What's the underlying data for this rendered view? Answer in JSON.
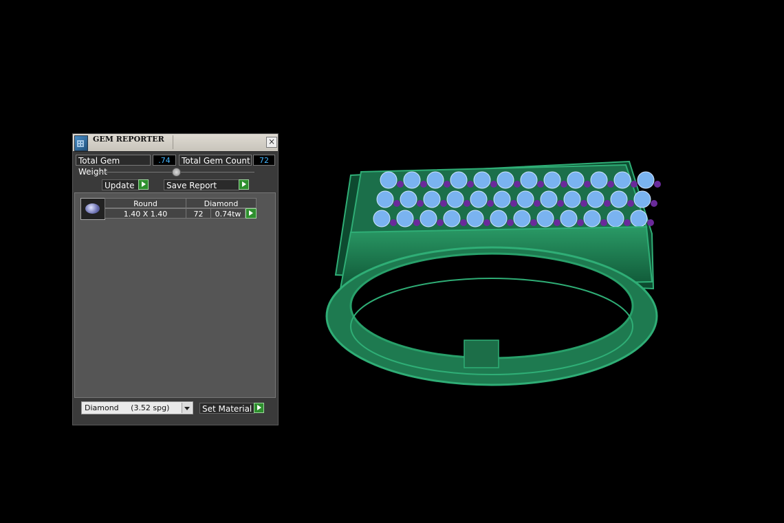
{
  "panel": {
    "title": "GEM REPORTER",
    "close_label": "×",
    "total_weight_label": "Total Gem Weight",
    "total_weight_value": ".74",
    "total_count_label": "Total Gem Count",
    "total_count_value": "72",
    "update_label": "Update",
    "save_report_label": "Save Report",
    "gems": [
      {
        "shape": "Round",
        "material": "Diamond",
        "size": "1.40 X 1.40",
        "count": "72",
        "weight": "0.74tw"
      }
    ],
    "material_select_value": "Diamond     (3.52 spg)",
    "set_material_label": "Set Material"
  },
  "colors": {
    "accent_value": "#45b7ff",
    "ring_metal": "#1f7a4f",
    "gem_blue": "#7ab3f0",
    "gem_purple": "#6a2a9a",
    "button_green": "#2e8f2e"
  }
}
